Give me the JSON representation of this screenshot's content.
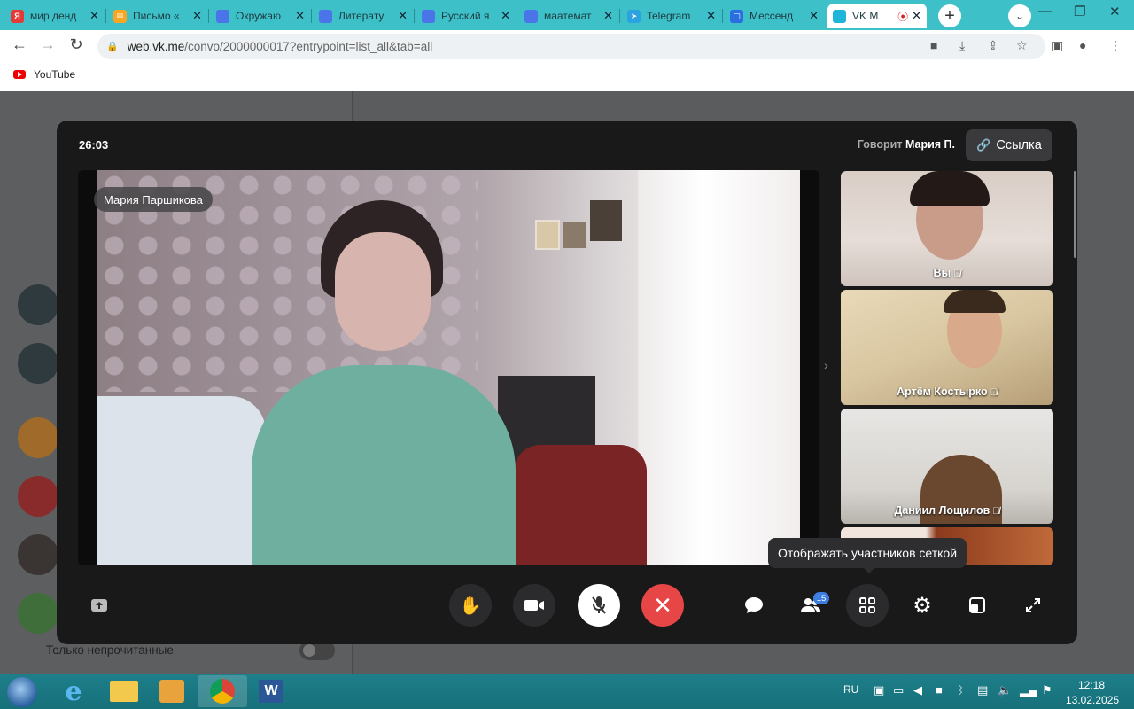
{
  "browser": {
    "tabs": [
      {
        "title": "мир денд",
        "favicon": "yandex-icon",
        "color": "#e53935",
        "glyph": "Я"
      },
      {
        "title": "Письмо «",
        "favicon": "mail-icon",
        "color": "#f5a623",
        "glyph": "✉"
      },
      {
        "title": "Окружаю",
        "favicon": "doc-icon",
        "color": "#4a74e8",
        "glyph": ""
      },
      {
        "title": "Литерату",
        "favicon": "doc-icon",
        "color": "#4a74e8",
        "glyph": ""
      },
      {
        "title": "Русский я",
        "favicon": "doc-icon",
        "color": "#4a74e8",
        "glyph": ""
      },
      {
        "title": "маатемат",
        "favicon": "doc-icon",
        "color": "#4a74e8",
        "glyph": ""
      },
      {
        "title": "Telegram",
        "favicon": "telegram-icon",
        "color": "#2aa3e0",
        "glyph": "➤"
      },
      {
        "title": "Мессенд",
        "favicon": "messenger-icon",
        "color": "#2a6ee0",
        "glyph": "▢"
      },
      {
        "title": "VK M",
        "favicon": "vk-icon",
        "color": "#1fb5d9",
        "glyph": "",
        "active": true
      }
    ],
    "url_host": "web.vk.me",
    "url_path": "/convo/2000000017?entrypoint=list_all&tab=all",
    "bookmarks": [
      {
        "label": "YouTube"
      }
    ]
  },
  "background": {
    "unread_label": "Только непрочитанные"
  },
  "call": {
    "timer": "26:03",
    "speaking_prefix": "Говорит",
    "speaking_name": "Мария П.",
    "link_label": "Ссылка",
    "main_participant": "Мария Паршикова",
    "thumbnails": [
      {
        "name": "Вы"
      },
      {
        "name": "Артём Костырко"
      },
      {
        "name": "Даниил Лощилов"
      },
      {
        "name": ""
      }
    ],
    "tooltip": "Отображать участников сеткой",
    "participants_count": "15"
  },
  "taskbar": {
    "lang": "RU",
    "time": "12:18",
    "date": "13.02.2025"
  }
}
